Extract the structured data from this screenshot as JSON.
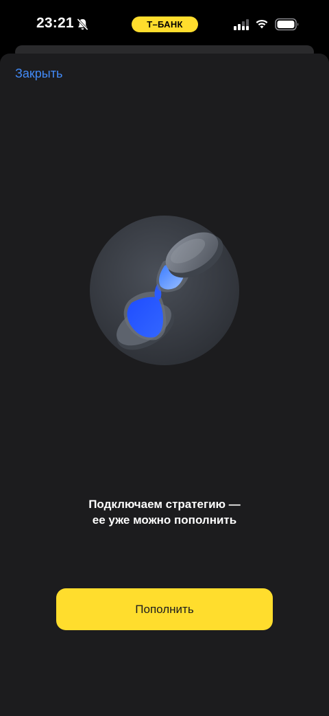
{
  "status_bar": {
    "time": "23:21",
    "carrier": "Т–БАНК",
    "icons": [
      "bell-slash-icon",
      "signal-icon",
      "wifi-icon",
      "battery-icon"
    ]
  },
  "sheet": {
    "close_label": "Закрыть",
    "illustration_icon": "hourglass-icon",
    "message_line1": "Подключаем стратегию —",
    "message_line2": "ее уже можно пополнить",
    "topup_button_label": "Пополнить"
  },
  "colors": {
    "background": "#000000",
    "sheet": "#1c1c1e",
    "accent_link": "#428bf9",
    "brand_yellow": "#ffdd2d",
    "illustration_blue": "#2b5bff"
  }
}
